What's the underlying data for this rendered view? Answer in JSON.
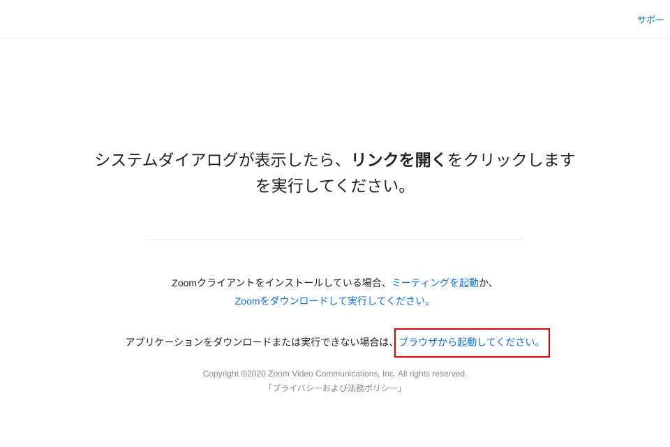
{
  "header": {
    "support_label": "サポー"
  },
  "main": {
    "headline_pre": "システムダイアログが表示したら、",
    "headline_bold": "リンクを開く",
    "headline_post": "をクリックします",
    "headline_line2": "を実行してください。",
    "instruction1_pre": "Zoomクライアントをインストールしている場合、",
    "instruction1_link": "ミーティングを起動",
    "instruction1_post": "か、",
    "instruction1b_link": "Zoomをダウンロードして実行してください。",
    "instruction2_pre": "アプリケーションをダウンロードまたは実行できない場合は、",
    "instruction2_link": "ブラウザから起動してください。"
  },
  "footer": {
    "copyright": "Copyright ©2020 Zoom Video Communications, Inc. All rights reserved.",
    "policy_link": "「プライバシーおよび法務ポリシー」"
  }
}
